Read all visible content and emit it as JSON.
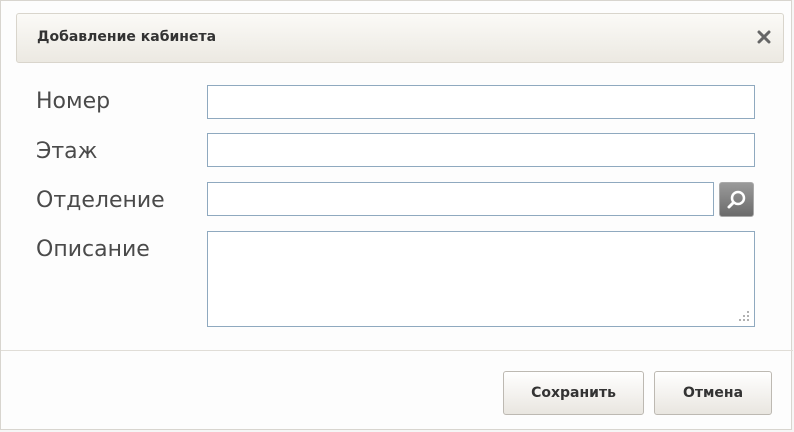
{
  "dialog": {
    "title": "Добавление кабинета",
    "close_icon": "close-icon"
  },
  "form": {
    "number_label": "Номер",
    "number_value": "",
    "floor_label": "Этаж",
    "floor_value": "",
    "department_label": "Отделение",
    "department_value": "",
    "department_search_icon": "search-icon",
    "description_label": "Описание",
    "description_value": ""
  },
  "footer": {
    "save_label": "Сохранить",
    "cancel_label": "Отмена"
  },
  "colors": {
    "input_border": "#8fa9bf",
    "titlebar_bg": "#ece9e2",
    "search_button": "#7b7b7b"
  }
}
